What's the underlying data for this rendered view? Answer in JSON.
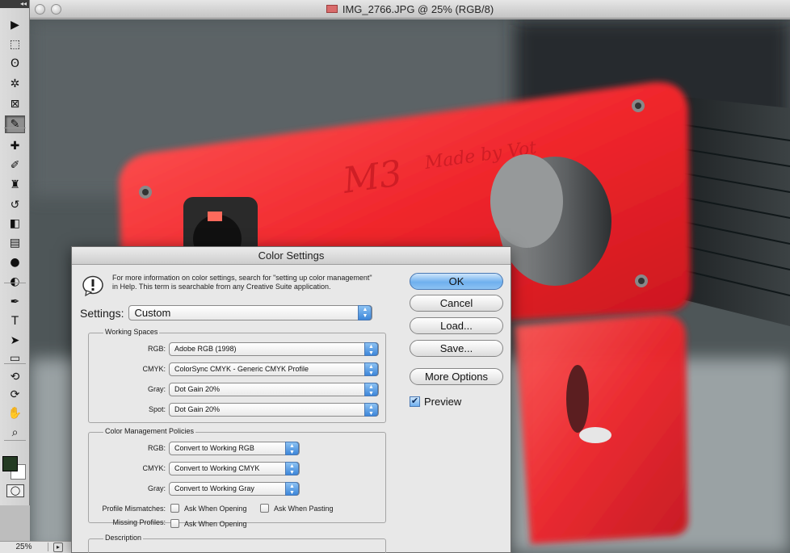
{
  "document": {
    "title": "IMG_2766.JPG @ 25% (RGB/8)"
  },
  "tools": [
    {
      "name": "move-tool",
      "glyph": "▶"
    },
    {
      "name": "marquee-tool",
      "glyph": "⬚"
    },
    {
      "name": "lasso-tool",
      "glyph": "ʘ"
    },
    {
      "name": "magic-wand-tool",
      "glyph": "✲"
    },
    {
      "name": "crop-tool",
      "glyph": "⊠"
    },
    {
      "name": "eyedropper-tool",
      "glyph": "✎"
    },
    {
      "name": "healing-brush-tool",
      "glyph": "✚"
    },
    {
      "name": "brush-tool",
      "glyph": "✐"
    },
    {
      "name": "clone-stamp-tool",
      "glyph": "♜"
    },
    {
      "name": "history-brush-tool",
      "glyph": "↺"
    },
    {
      "name": "eraser-tool",
      "glyph": "◧"
    },
    {
      "name": "gradient-tool",
      "glyph": "▤"
    },
    {
      "name": "blur-tool",
      "glyph": "●"
    },
    {
      "name": "dodge-tool",
      "glyph": "◐"
    },
    {
      "name": "pen-tool",
      "glyph": "✒"
    },
    {
      "name": "type-tool",
      "glyph": "T"
    },
    {
      "name": "path-selection-tool",
      "glyph": "➤"
    },
    {
      "name": "shape-tool",
      "glyph": "▭"
    },
    {
      "name": "3d-rotate-tool",
      "glyph": "⟲"
    },
    {
      "name": "3d-orbit-tool",
      "glyph": "⟳"
    },
    {
      "name": "hand-tool",
      "glyph": "✋"
    },
    {
      "name": "zoom-tool",
      "glyph": "⌕"
    }
  ],
  "colors": {
    "foreground": "#233a22",
    "background": "#ffffff",
    "accent": "#6fb0ee"
  },
  "statusbar": {
    "zoom": "25%"
  },
  "dialog": {
    "title": "Color Settings",
    "info": "For more information on color settings, search for \"setting up color management\" in Help. This term is searchable from any Creative Suite application.",
    "settings_label": "Settings:",
    "settings_value": "Custom",
    "buttons": {
      "ok": "OK",
      "cancel": "Cancel",
      "load": "Load...",
      "save": "Save...",
      "more_options": "More Options"
    },
    "preview_label": "Preview",
    "preview_checked": true,
    "working_spaces": {
      "title": "Working Spaces",
      "rgb_label": "RGB:",
      "rgb_value": "Adobe RGB (1998)",
      "cmyk_label": "CMYK:",
      "cmyk_value": "ColorSync CMYK - Generic CMYK Profile",
      "gray_label": "Gray:",
      "gray_value": "Dot Gain 20%",
      "spot_label": "Spot:",
      "spot_value": "Dot Gain 20%"
    },
    "policies": {
      "title": "Color Management Policies",
      "rgb_label": "RGB:",
      "rgb_value": "Convert to Working RGB",
      "cmyk_label": "CMYK:",
      "cmyk_value": "Convert to Working CMYK",
      "gray_label": "Gray:",
      "gray_value": "Convert to Working Gray",
      "mismatch_label": "Profile Mismatches:",
      "ask_opening": "Ask When Opening",
      "ask_pasting": "Ask When Pasting",
      "missing_label": "Missing Profiles:",
      "missing_ask_opening": "Ask When Opening"
    },
    "description": {
      "title": "Description"
    }
  }
}
